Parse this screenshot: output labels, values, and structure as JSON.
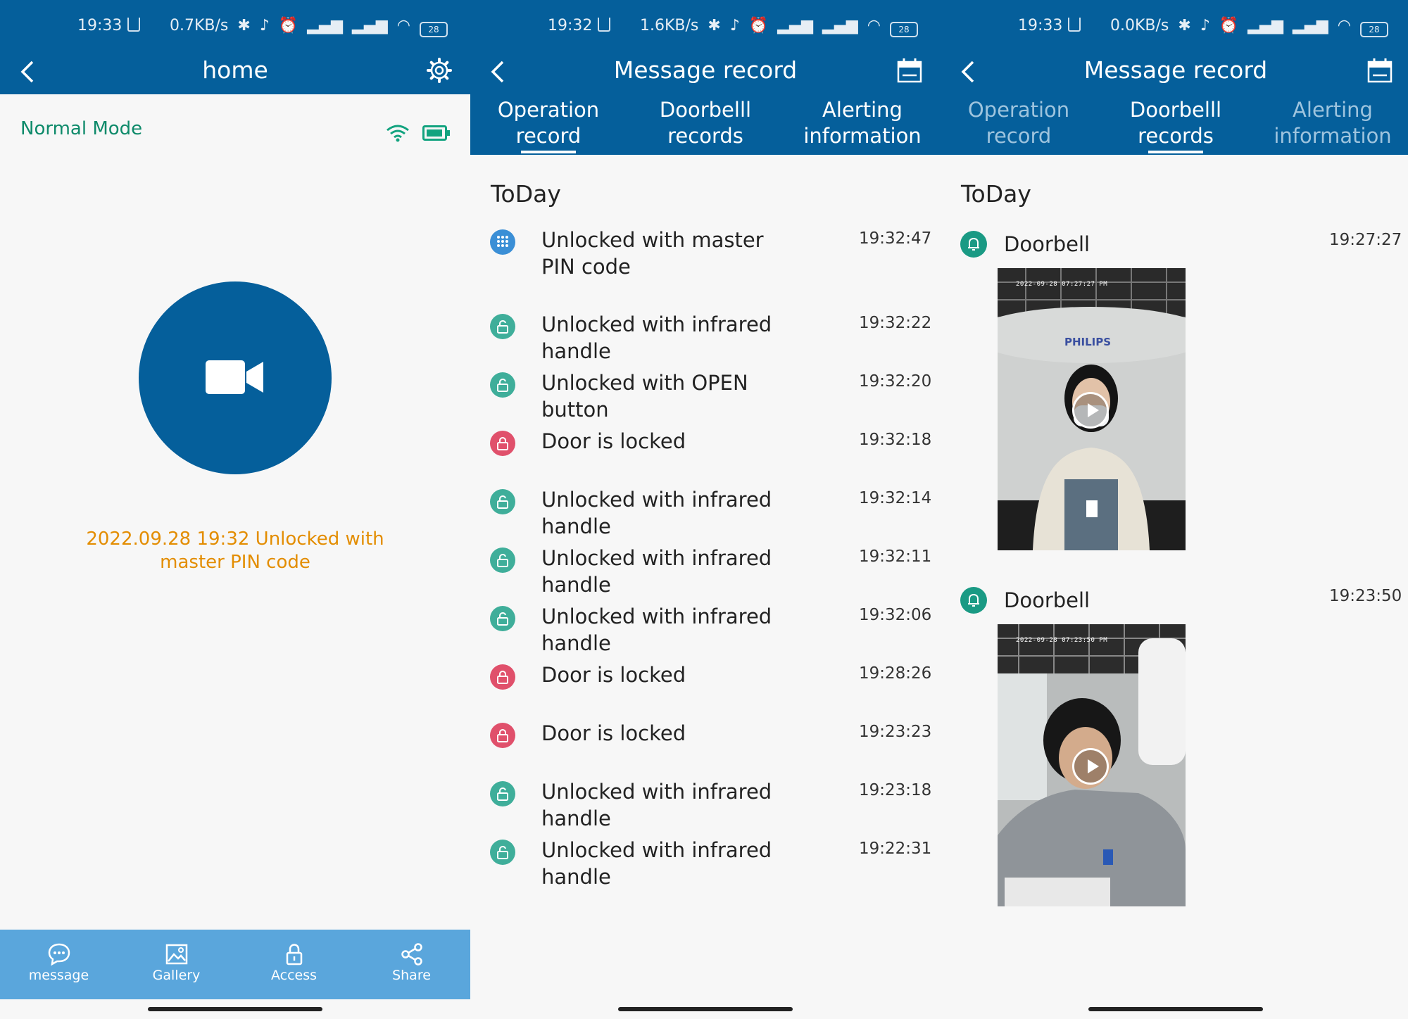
{
  "status": [
    {
      "time": "19:33",
      "speed": "0.7KB/s",
      "battery": "28"
    },
    {
      "time": "19:32",
      "speed": "1.6KB/s",
      "battery": "28"
    },
    {
      "time": "19:33",
      "speed": "0.0KB/s",
      "battery": "28"
    }
  ],
  "home": {
    "title": "home",
    "mode": "Normal Mode",
    "last_event": "2022.09.28 19:32 Unlocked with master PIN code",
    "nav": [
      {
        "label": "message"
      },
      {
        "label": "Gallery"
      },
      {
        "label": "Access"
      },
      {
        "label": "Share"
      }
    ]
  },
  "message_record": {
    "title": "Message record",
    "tabs": [
      {
        "line1": "Operation",
        "line2": "record"
      },
      {
        "line1": "Doorbelll",
        "line2": "records"
      },
      {
        "line1": "Alerting",
        "line2": "information"
      }
    ],
    "section": "ToDay"
  },
  "operations": [
    {
      "text": "Unlocked with master PIN code",
      "time": "19:32:47",
      "kind": "pin"
    },
    {
      "text": "Unlocked with infrared handle",
      "time": "19:32:22",
      "kind": "unlock"
    },
    {
      "text": "Unlocked with OPEN button",
      "time": "19:32:20",
      "kind": "unlock"
    },
    {
      "text": "Door is locked",
      "time": "19:32:18",
      "kind": "lock"
    },
    {
      "text": "Unlocked with infrared handle",
      "time": "19:32:14",
      "kind": "unlock"
    },
    {
      "text": "Unlocked with infrared handle",
      "time": "19:32:11",
      "kind": "unlock"
    },
    {
      "text": "Unlocked with infrared handle",
      "time": "19:32:06",
      "kind": "unlock"
    },
    {
      "text": "Door is locked",
      "time": "19:28:26",
      "kind": "lock"
    },
    {
      "text": "Door is locked",
      "time": "19:23:23",
      "kind": "lock"
    },
    {
      "text": "Unlocked with infrared handle",
      "time": "19:23:18",
      "kind": "unlock"
    },
    {
      "text": "Unlocked with infrared handle",
      "time": "19:22:31",
      "kind": "unlock"
    }
  ],
  "doorbell": [
    {
      "text": "Doorbell",
      "time": "19:27:27",
      "stamp": "2022-09-28 07:27:27 PM",
      "brand": "PHILIPS"
    },
    {
      "text": "Doorbell",
      "time": "19:23:50",
      "stamp": "2022-09-28 07:23:50 PM"
    }
  ],
  "colors": {
    "primary": "#055f9b",
    "nav": "#5aa6dc",
    "unlock": "#3fae9a",
    "lock": "#e0506b",
    "pin": "#3b8fd6",
    "accent": "#e38d00",
    "mode": "#0e8a6a"
  },
  "icons": {
    "back": "chevron-left-icon",
    "settings": "gear-icon",
    "calendar": "calendar-icon",
    "video": "video-camera-icon",
    "doorbell": "bell-icon"
  }
}
